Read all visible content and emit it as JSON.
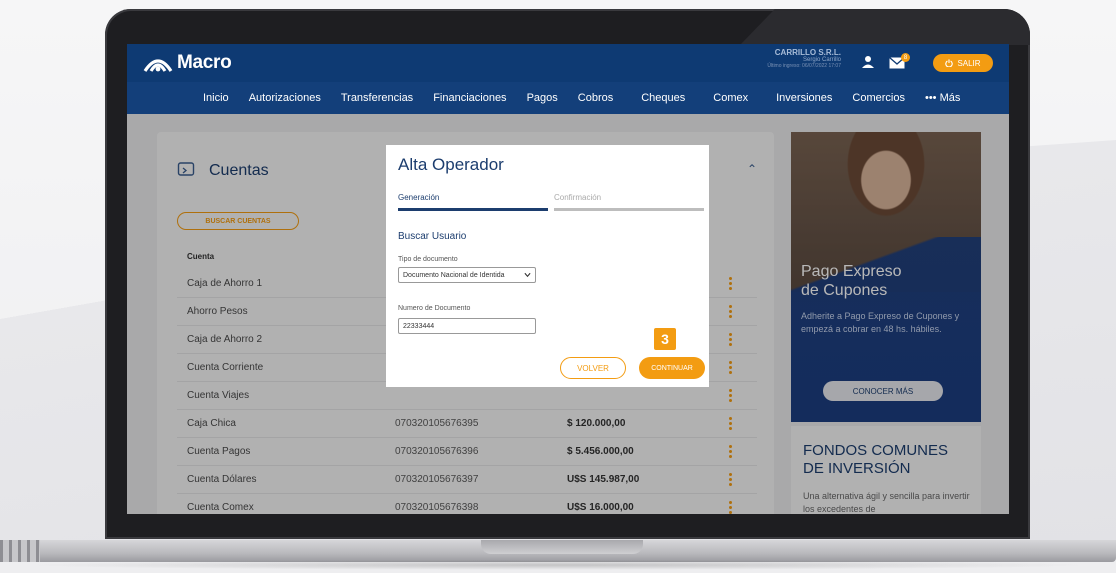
{
  "app": {
    "brand": "Macro",
    "user_name": "CARRILLO S.R.L.",
    "user_sub": "Sergio Carrillo",
    "user_last": "Último ingreso: 06/07/2022 17:07",
    "notifications_count": "8",
    "logout_label": "SALIR"
  },
  "nav": {
    "items": [
      "Inicio",
      "Autorizaciones",
      "Transferencias",
      "Financiaciones",
      "Pagos",
      "Cobros",
      "Cheques",
      "Comex",
      "Inversiones",
      "Comercios",
      "••• Más"
    ]
  },
  "cuentas": {
    "title": "Cuentas",
    "search_button": "BUSCAR CUENTAS",
    "col_header": "Cuenta",
    "rows": [
      {
        "name": "Caja de Ahorro 1",
        "number": "",
        "amount": ""
      },
      {
        "name": "Ahorro Pesos",
        "number": "",
        "amount": ""
      },
      {
        "name": "Caja de Ahorro 2",
        "number": "",
        "amount": ""
      },
      {
        "name": "Cuenta Corriente",
        "number": "",
        "amount": ""
      },
      {
        "name": "Cuenta Viajes",
        "number": "",
        "amount": ""
      },
      {
        "name": "Caja Chica",
        "number": "070320105676395",
        "amount": "$ 120.000,00"
      },
      {
        "name": "Cuenta Pagos",
        "number": "070320105676396",
        "amount": "$ 5.456.000,00"
      },
      {
        "name": "Cuenta Dólares",
        "number": "070320105676397",
        "amount": "U$S 145.987,00"
      },
      {
        "name": "Cuenta Comex",
        "number": "070320105676398",
        "amount": "U$S 16.000,00"
      }
    ]
  },
  "promo": {
    "title_line1": "Pago Expreso",
    "title_line2": "de Cupones",
    "text": "Adherite a Pago Expreso de Cupones y empezá a cobrar en 48 hs. hábiles.",
    "button": "CONOCER MÁS"
  },
  "fondos": {
    "title_line1": "FONDOS COMUNES",
    "title_line2": "DE INVERSIÓN",
    "text": "Una alternativa ágil y sencilla para invertir los excedentes de"
  },
  "modal": {
    "title": "Alta Operador",
    "step1": "Generación",
    "step2": "Confirmación",
    "section": "Buscar Usuario",
    "doc_type_label": "Tipo de documento",
    "doc_type_value": "Documento Nacional de Identida",
    "doc_number_label": "Numero de Documento",
    "doc_number_value": "22333444",
    "back_button": "VOLVER",
    "continue_button": "CONTINUAR",
    "step_badge": "3"
  },
  "colors": {
    "brand_blue": "#0e3a73",
    "accent_orange": "#f39c12",
    "step_active": "#1c3d6e",
    "step_inactive": "#bdbdbd"
  }
}
